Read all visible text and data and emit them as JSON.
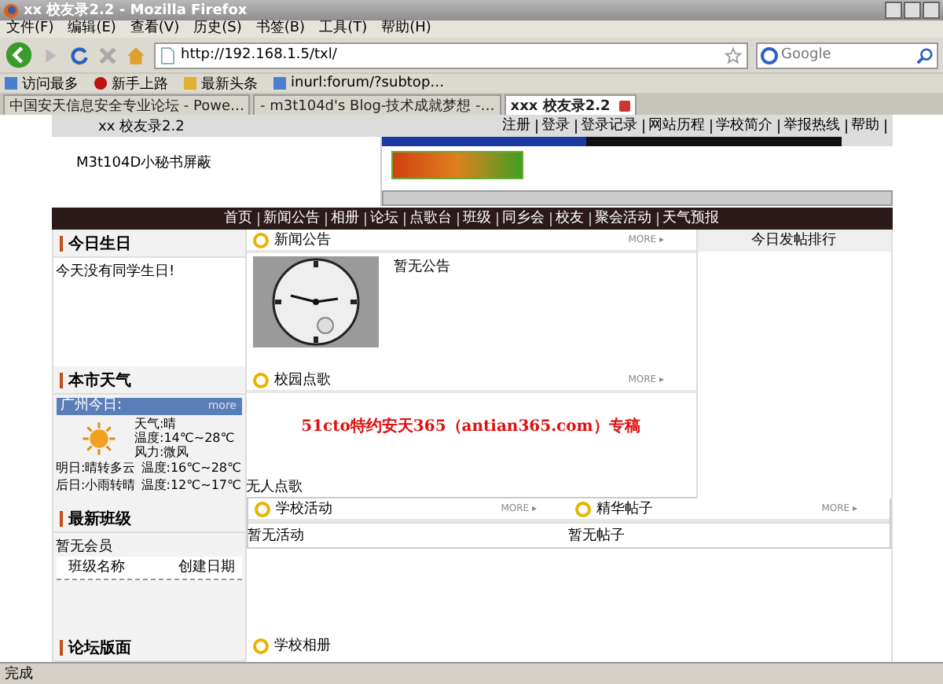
{
  "window": {
    "title": "xx 校友录2.2 - Mozilla Firefox"
  },
  "menu": [
    "文件(F)",
    "编辑(E)",
    "查看(V)",
    "历史(S)",
    "书签(B)",
    "工具(T)",
    "帮助(H)"
  ],
  "toolbar": {
    "url": "http://192.168.1.5/txl/",
    "search_placeholder": "Google"
  },
  "bookmarks": [
    "访问最多",
    "新手上路",
    "最新头条",
    "inurl:forum/?subtop…"
  ],
  "tabs": [
    {
      "label": "中国安天信息安全专业论坛 - Powe…",
      "selected": false
    },
    {
      "label": "- m3t104d's Blog-技术成就梦想 -…",
      "selected": false
    },
    {
      "label": "xxx 校友录2.2",
      "selected": true
    }
  ],
  "page": {
    "site_title": "xx 校友录2.2",
    "top_links": [
      "注册",
      "登录",
      "登录记录",
      "网站历程",
      "学校简介",
      "举报热线",
      "帮助"
    ],
    "notice": "M3t104D小秘书屏蔽",
    "nav": [
      "首页",
      "新闻公告",
      "相册",
      "论坛",
      "点歌台",
      "班级",
      "同乡会",
      "校友",
      "聚会活动",
      "天气预报"
    ],
    "birthday": {
      "title": "今日生日",
      "text": "今天没有同学生日!"
    },
    "weather": {
      "title": "本市天气",
      "city": "广州今日:",
      "more": "more",
      "today": [
        "天气:晴",
        "温度:14℃~28℃",
        "风力:微风"
      ],
      "forecast": [
        {
          "day": "明日:晴转多云",
          "temp": "温度:16℃~28℃"
        },
        {
          "day": "后日:小雨转晴",
          "temp": "温度:12℃~17℃"
        }
      ]
    },
    "classes": {
      "title": "最新班级",
      "empty": "暂无会员",
      "columns": [
        "班级名称",
        "创建日期"
      ]
    },
    "forum": {
      "title": "论坛版面"
    },
    "news": {
      "title": "新闻公告",
      "more": "MORE ▸",
      "text": "暂无公告"
    },
    "ranking": {
      "title": "今日发帖排行"
    },
    "songs": {
      "title": "校园点歌",
      "more": "MORE ▸",
      "banner": "51cto特约安天365（antian365.com）专稿",
      "text": "无人点歌"
    },
    "activities": {
      "title": "学校活动",
      "more": "MORE ▸",
      "text": "暂无活动"
    },
    "posts": {
      "title": "精华帖子",
      "more": "MORE ▸",
      "text": "暂无帖子"
    },
    "album": {
      "title": "学校相册"
    }
  },
  "status_bar": "完成"
}
